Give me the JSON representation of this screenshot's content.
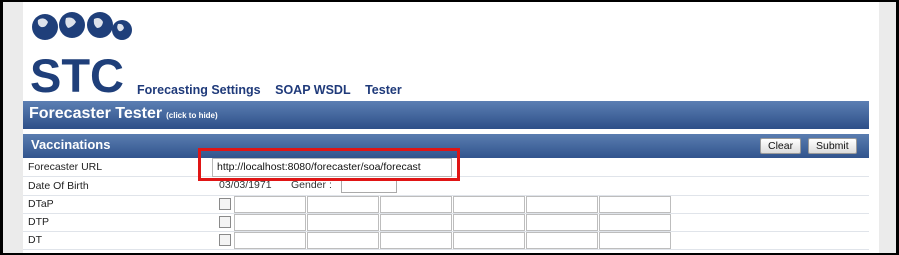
{
  "logo": {
    "text": "STC"
  },
  "nav": {
    "items": [
      "Forecasting Settings",
      "SOAP WSDL",
      "Tester"
    ]
  },
  "tester": {
    "title": "Forecaster Tester",
    "hint": "(click to hide)"
  },
  "vaccinations": {
    "title": "Vaccinations",
    "clear_label": "Clear",
    "submit_label": "Submit"
  },
  "form": {
    "forecaster_url_label": "Forecaster URL",
    "forecaster_url_value": "http://localhost:8080/forecaster/soa/forecast",
    "dob_label": "Date Of Birth",
    "dob_value": "03/03/1971",
    "gender_label": "Gender :"
  },
  "vaccine_rows": [
    "DTaP",
    "DTP",
    "DT"
  ],
  "colors": {
    "header_bar": "#3a5c94",
    "nav_link": "#1f3a7a",
    "highlight": "#e01515"
  }
}
